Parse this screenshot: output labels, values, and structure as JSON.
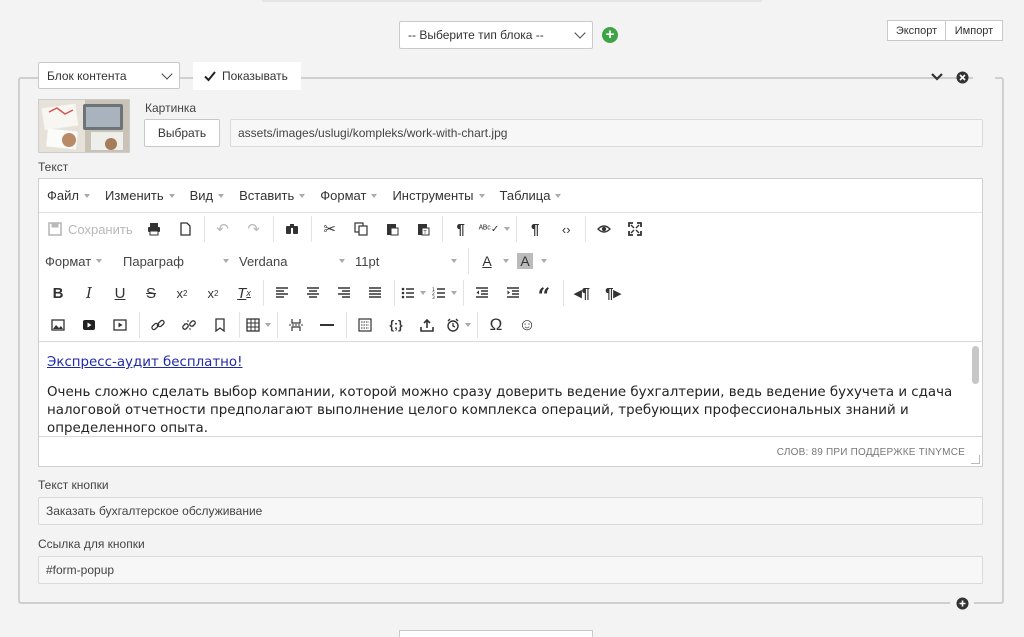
{
  "topbar": {
    "block_type_select": "-- Выберите тип блока --",
    "export_label": "Экспорт",
    "import_label": "Импорт"
  },
  "block": {
    "type_select": "Блок контента",
    "show_label": "Показывать",
    "show_checked": true,
    "image_label": "Картинка",
    "choose_button": "Выбрать",
    "image_path": "assets/images/uslugi/kompleks/work-with-chart.jpg",
    "text_label": "Текст",
    "button_text_label": "Текст кнопки",
    "button_text_value": "Заказать бухгалтерское обслуживание",
    "button_link_label": "Ссылка для кнопки",
    "button_link_value": "#form-popup"
  },
  "editor": {
    "menu": [
      "Файл",
      "Изменить",
      "Вид",
      "Вставить",
      "Формат",
      "Инструменты",
      "Таблица"
    ],
    "save_label": "Сохранить",
    "format_label": "Формат",
    "paragraph_label": "Параграф",
    "font_label": "Verdana",
    "size_label": "11pt",
    "content_link": "Экспресс-аудит бесплатно!",
    "content_paragraph": "Очень сложно сделать выбор компании, которой можно сразу доверить ведение бухгалтерии, ведь ведение бухучета и сдача налоговой отчетности предполагают выполнение целого комплекса операций, требующих профессиональных знаний и определенного опыта.",
    "status": "СЛОВ: 89 ПРИ ПОДДЕРЖКЕ TINYMCE"
  },
  "icons": {
    "add": "plus-circle-icon",
    "collapse": "chevron-down-icon",
    "remove": "close-circle-icon"
  },
  "colors": {
    "accent_green": "#3fa544",
    "link": "#1f2aa8"
  }
}
